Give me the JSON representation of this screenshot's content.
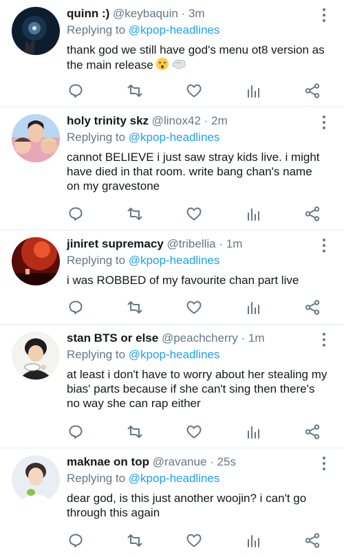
{
  "tweets": [
    {
      "name": "quinn :)",
      "handle": "@keybaquin",
      "separator": "·",
      "time": "3m",
      "reply_prefix": "Replying to",
      "reply_to": "@kpop-headlines",
      "text": "thank god we still have god's menu ot8 version as the main release",
      "emojis": [
        "hushed-face-emoji",
        "dash-emoji"
      ]
    },
    {
      "name": "holy trinity skz",
      "handle": "@linox42",
      "separator": "·",
      "time": "2m",
      "reply_prefix": "Replying to",
      "reply_to": "@kpop-headlines",
      "text": "cannot BELIEVE i just saw stray kids live. i might have died in that room. write bang chan's name on my gravestone"
    },
    {
      "name": "jiniret supremacy",
      "handle": "@tribellia",
      "separator": "·",
      "time": "1m",
      "reply_prefix": "Replying to",
      "reply_to": "@kpop-headlines",
      "text": "i was ROBBED of my favourite chan part live"
    },
    {
      "name": "stan BTS or else",
      "handle": "@peachcherry",
      "separator": "·",
      "time": "1m",
      "reply_prefix": "Replying to",
      "reply_to": "@kpop-headlines",
      "text": "at least i don't have to worry about her stealing my bias' parts because if she can't sing then there's no way she can rap either"
    },
    {
      "name": "maknae on top",
      "handle": "@ravanue",
      "separator": "·",
      "time": "25s",
      "reply_prefix": "Replying to",
      "reply_to": "@kpop-headlines",
      "text": "dear god, is this just another woojin? i can't go through this again"
    }
  ],
  "action_icons": [
    "reply-icon",
    "retweet-icon",
    "like-icon",
    "analytics-icon",
    "share-icon"
  ],
  "colors": {
    "name": "#14171a",
    "meta": "#657786",
    "mention": "#1da1f2",
    "divider": "#e6ecf0"
  }
}
